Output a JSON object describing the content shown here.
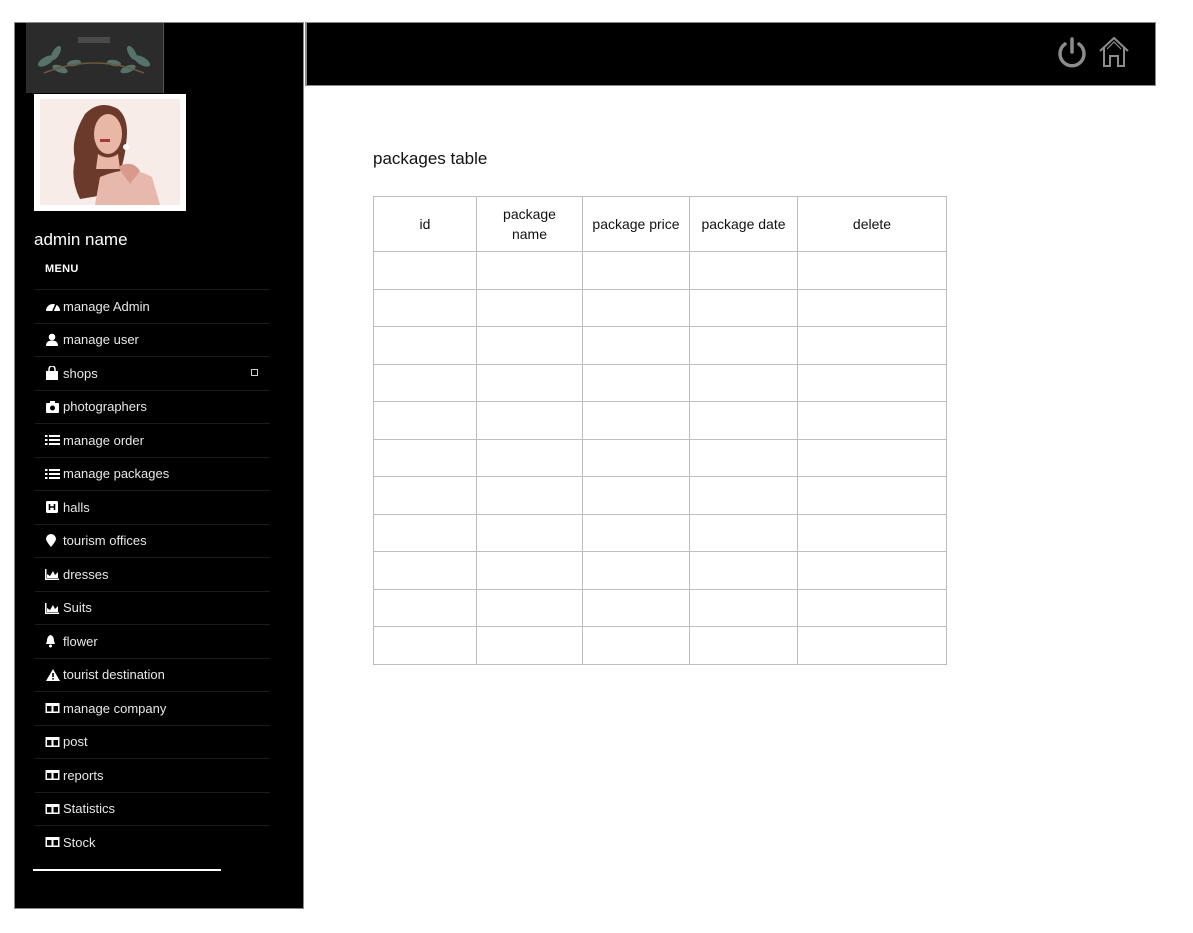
{
  "sidebar": {
    "admin_name": "admin name",
    "menu_label": "MENU",
    "items": [
      {
        "label": "manage Admin",
        "icon": "gauge-icon"
      },
      {
        "label": "manage user",
        "icon": "user-icon"
      },
      {
        "label": "shops",
        "icon": "shopping-bag-icon"
      },
      {
        "label": "photographers",
        "icon": "camera-icon"
      },
      {
        "label": "manage order",
        "icon": "list-icon"
      },
      {
        "label": "manage packages",
        "icon": "list-icon"
      },
      {
        "label": "halls",
        "icon": "hotel-icon"
      },
      {
        "label": "tourism offices",
        "icon": "map-marker-icon"
      },
      {
        "label": "dresses",
        "icon": "area-chart-icon"
      },
      {
        "label": "Suits",
        "icon": "area-chart-icon"
      },
      {
        "label": "flower",
        "icon": "bell-icon"
      },
      {
        "label": "tourist destination",
        "icon": "warning-icon"
      },
      {
        "label": "manage company",
        "icon": "columns-icon"
      },
      {
        "label": "post",
        "icon": "columns-icon"
      },
      {
        "label": "reports",
        "icon": "columns-icon"
      },
      {
        "label": "Statistics",
        "icon": "columns-icon"
      },
      {
        "label": "Stock",
        "icon": "columns-icon"
      }
    ]
  },
  "topbar": {
    "icons": [
      "power-icon",
      "home-icon"
    ]
  },
  "main": {
    "heading": "packages table",
    "table": {
      "columns": [
        "id",
        "package name",
        "package price",
        "package date",
        "delete"
      ],
      "rows": [
        [
          "",
          "",
          "",
          "",
          ""
        ],
        [
          "",
          "",
          "",
          "",
          ""
        ],
        [
          "",
          "",
          "",
          "",
          ""
        ],
        [
          "",
          "",
          "",
          "",
          ""
        ],
        [
          "",
          "",
          "",
          "",
          ""
        ],
        [
          "",
          "",
          "",
          "",
          ""
        ],
        [
          "",
          "",
          "",
          "",
          ""
        ],
        [
          "",
          "",
          "",
          "",
          ""
        ],
        [
          "",
          "",
          "",
          "",
          ""
        ],
        [
          "",
          "",
          "",
          "",
          ""
        ],
        [
          "",
          "",
          "",
          "",
          ""
        ]
      ]
    }
  },
  "colors": {
    "sidebar_bg": "#000000",
    "topbar_bg": "#000000",
    "icon_gray": "#8c8c8c"
  }
}
